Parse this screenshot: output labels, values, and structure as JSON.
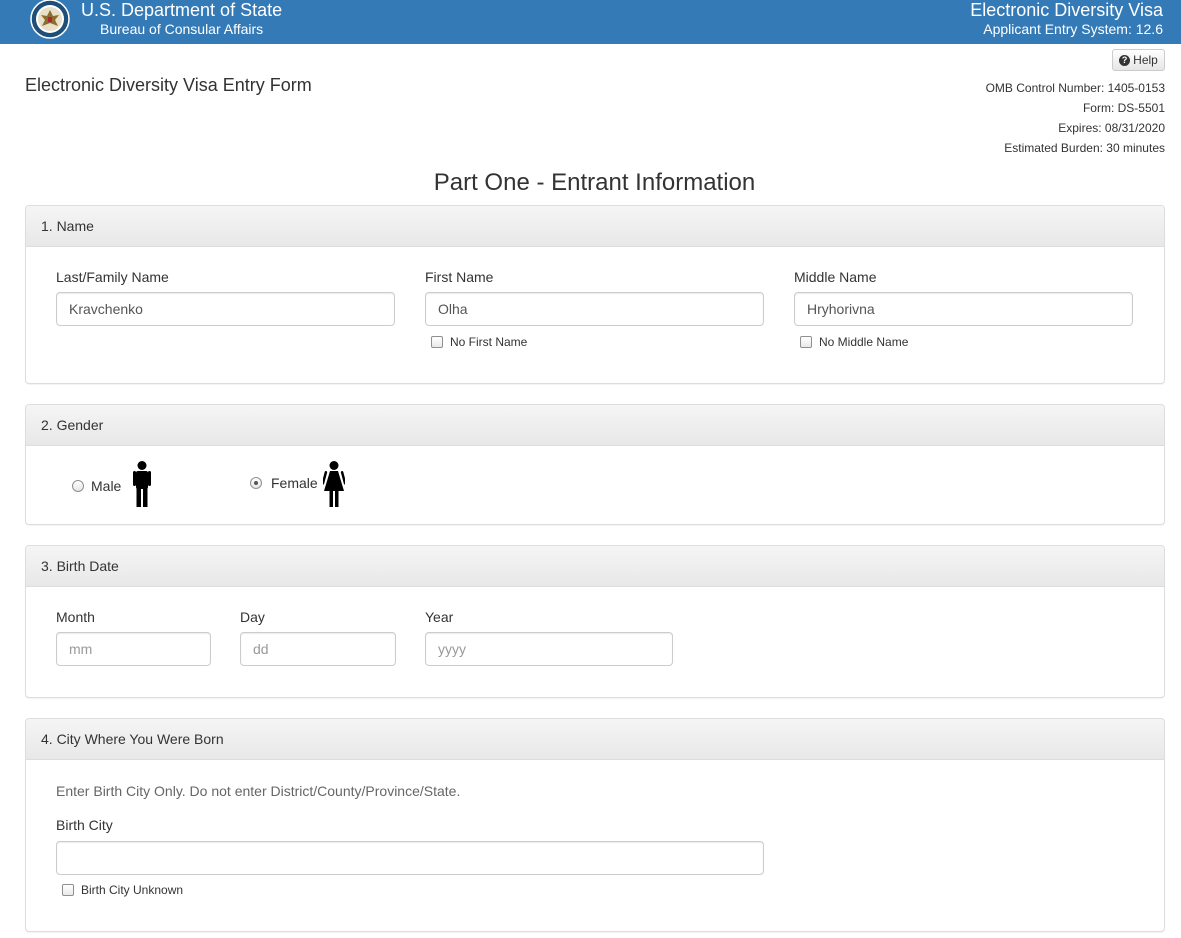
{
  "header": {
    "dept_title": "U.S. Department of State",
    "dept_subtitle": "Bureau of Consular Affairs",
    "system_title": "Electronic Diversity Visa",
    "system_subtitle": "Applicant Entry System: 12.6",
    "brand_color": "#337ab7",
    "seal_icon": "state-department-seal-icon"
  },
  "help_button": {
    "label": "Help",
    "icon": "question-circle-icon"
  },
  "form_title": "Electronic Diversity Visa Entry Form",
  "omb": {
    "control_number": "OMB Control Number: 1405-0153",
    "form": "Form: DS-5501",
    "expires": "Expires: 08/31/2020",
    "burden": "Estimated Burden: 30 minutes"
  },
  "part_title": "Part One - Entrant Information",
  "name_section": {
    "heading": "1. Name",
    "last_label": "Last/Family Name",
    "last_value": "Kravchenko",
    "first_label": "First Name",
    "first_value": "Olha",
    "no_first_label": "No First Name",
    "middle_label": "Middle Name",
    "middle_value": "Hryhorivna",
    "no_middle_label": "No Middle Name"
  },
  "gender_section": {
    "heading": "2. Gender",
    "male_label": "Male",
    "female_label": "Female",
    "selected": "Female"
  },
  "birth_date_section": {
    "heading": "3. Birth Date",
    "month_label": "Month",
    "month_placeholder": "mm",
    "day_label": "Day",
    "day_placeholder": "dd",
    "year_label": "Year",
    "year_placeholder": "yyyy"
  },
  "birth_city_section": {
    "heading": "4. City Where You Were Born",
    "instruction": "Enter Birth City Only. Do not enter District/County/Province/State.",
    "city_label": "Birth City",
    "city_value": "",
    "unknown_label": "Birth City Unknown"
  }
}
